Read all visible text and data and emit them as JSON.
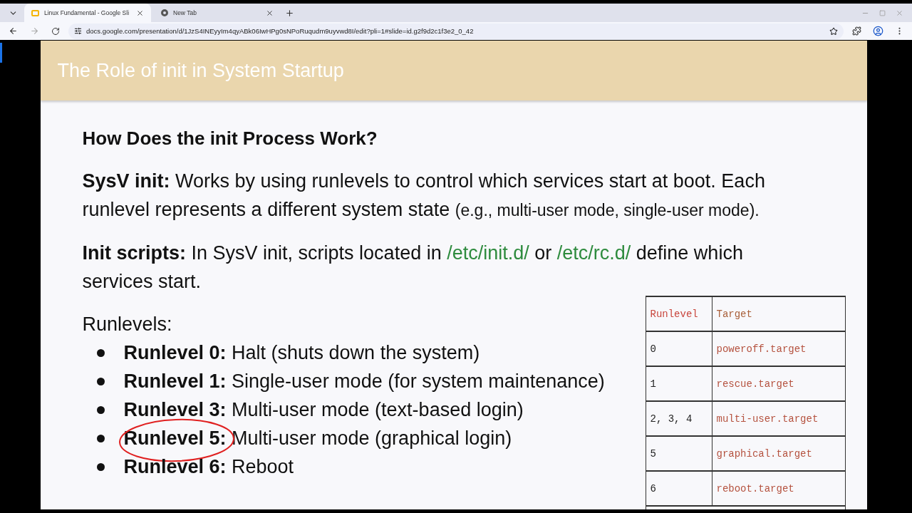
{
  "browser": {
    "tabs": [
      {
        "title": "Linux Fundamental - Google Sli",
        "kind": "slides",
        "selected": true
      },
      {
        "title": "New Tab",
        "kind": "chrome",
        "selected": false
      }
    ],
    "url": "docs.google.com/presentation/d/1JzS4INEyyIm4qyABk06IwHPg0sNPoRuqudm9uyvwd8I/edit?pli=1#slide=id.g2f9d2c1f3e2_0_42"
  },
  "slide": {
    "title": "The Role of init in System Startup",
    "heading": "How Does the init Process Work?",
    "paragraphs": [
      [
        {
          "kind": "bold",
          "text": "SysV init:"
        },
        {
          "kind": "text",
          "text": " Works by using runlevels to control which services start at boot. Each runlevel represents a different system state "
        },
        {
          "kind": "small",
          "text": "(e.g., multi-user mode, single-user mode)."
        }
      ],
      [
        {
          "kind": "bold",
          "text": "Init scripts:"
        },
        {
          "kind": "text",
          "text": " In SysV init, scripts located in "
        },
        {
          "kind": "path",
          "text": "/etc/init.d/"
        },
        {
          "kind": "text",
          "text": " or "
        },
        {
          "kind": "path",
          "text": "/etc/rc.d/"
        },
        {
          "kind": "text",
          "text": " define which services start."
        }
      ]
    ],
    "list_label": "Runlevels:",
    "runlevels": [
      {
        "label": "Runlevel 0:",
        "description": " Halt (shuts down the system)",
        "circled": false
      },
      {
        "label": "Runlevel 1:",
        "description": " Single-user mode (for system maintenance)",
        "circled": false
      },
      {
        "label": "Runlevel 3:",
        "description": " Multi-user mode (text-based login)",
        "circled": false
      },
      {
        "label": "Runlevel 5:",
        "description": " Multi-user mode (graphical login)",
        "circled": true
      },
      {
        "label": "Runlevel 6:",
        "description": " Reboot",
        "circled": false
      }
    ],
    "table": {
      "columns": [
        "Runlevel",
        "Target"
      ],
      "rows": [
        [
          "0",
          "poweroff.target"
        ],
        [
          "1",
          "rescue.target"
        ],
        [
          "2, 3, 4",
          "multi-user.target"
        ],
        [
          "5",
          "graphical.target"
        ],
        [
          "6",
          "reboot.target"
        ]
      ]
    }
  }
}
